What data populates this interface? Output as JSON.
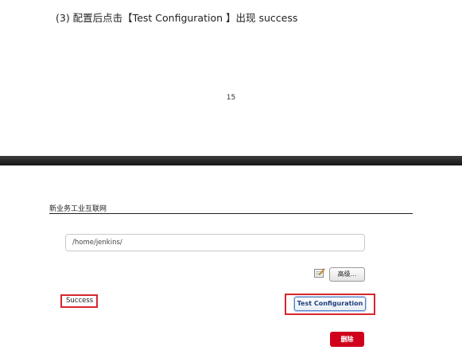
{
  "document": {
    "instruction": "(3) 配置后点击【Test Configuration 】出现 success",
    "page_number": "15"
  },
  "config_section": {
    "title": "新业务工业互联网",
    "path_value": "/home/jenkins/",
    "advanced_label": "高级...",
    "status_text": "Success",
    "test_button_label": "Test Configuration",
    "delete_label": "删除"
  },
  "icons": {
    "advanced_icon": "notepad-icon"
  },
  "colors": {
    "highlight": "#d7262d",
    "delete_button": "#d0021b",
    "test_button_border": "#4f81c7"
  }
}
